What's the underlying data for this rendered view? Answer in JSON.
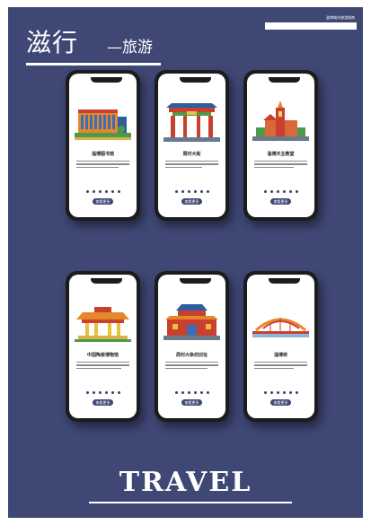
{
  "header": {
    "title_main": "滋行",
    "title_sub": "—旅游",
    "top_right_text": "滋博城市旅游指南"
  },
  "cards": [
    {
      "title": "淄博图书馆",
      "button": "查看更多",
      "illustration": "library-building-icon"
    },
    {
      "title": "周村大街",
      "button": "查看更多",
      "illustration": "gate-archway-icon"
    },
    {
      "title": "淄博天主教堂",
      "button": "查看更多",
      "illustration": "church-icon"
    },
    {
      "title": "中国陶瓷博物馆",
      "button": "查看更多",
      "illustration": "museum-pavilion-icon"
    },
    {
      "title": "周村大染坊旧址",
      "button": "查看更多",
      "illustration": "memorial-hall-icon"
    },
    {
      "title": "淄博桥",
      "button": "查看更多",
      "illustration": "bridge-icon"
    }
  ],
  "footer": {
    "travel": "TRAVEL"
  },
  "colors": {
    "background": "#3f4775",
    "accent_orange": "#e8862a",
    "accent_red": "#c9402f",
    "accent_green": "#4f9a4a"
  }
}
